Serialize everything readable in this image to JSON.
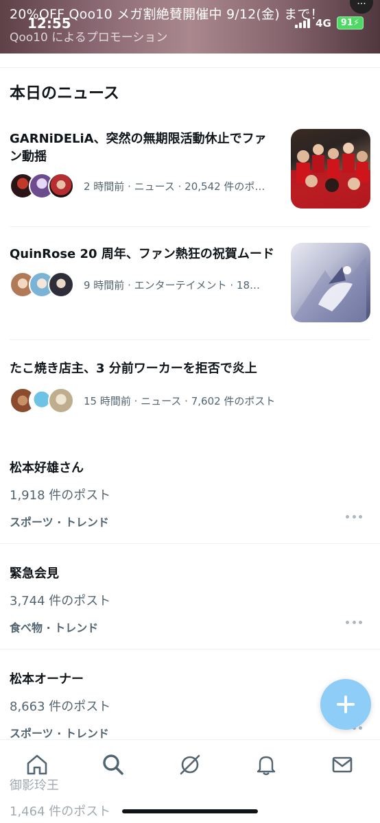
{
  "promo": {
    "title": "20%OFF Qoo10 メガ割絶賛開催中 9/12(金) まで！",
    "subtitle": "Qoo10 によるプロモーション"
  },
  "status_bar": {
    "time": "12:55",
    "network": "4G",
    "battery": "91"
  },
  "section": {
    "title": "本日のニュース"
  },
  "news": [
    {
      "headline": "GARNiDELiA、突然の無期限活動休止でファン動揺",
      "meta": "2 時間前 · ニュース · 20,542 件のポ…",
      "avatar_colors": [
        "#3a1d1f",
        "#6d4b8f",
        "#b62d32"
      ]
    },
    {
      "headline": "QuinRose 20 周年、ファン熱狂の祝賀ムード",
      "meta": "9 時間前 · エンターテイメント · 18…",
      "avatar_colors": [
        "#b07a56",
        "#7ab3d6",
        "#2e2e3a"
      ]
    },
    {
      "headline": "たこ焼き店主、3 分前ワーカーを拒否で炎上",
      "meta": "15 時間前 · ニュース · 7,602 件のポスト",
      "avatar_colors": [
        "#8a4b2e",
        "#6cc3e6",
        "#d8cbb0"
      ]
    }
  ],
  "trends": [
    {
      "name": "松本好雄さん",
      "count": "1,918 件のポスト",
      "category": "スポーツ · トレンド"
    },
    {
      "name": "緊急会見",
      "count": "3,744 件のポスト",
      "category": "食べ物 · トレンド"
    },
    {
      "name": "松本オーナー",
      "count": "8,663 件のポスト",
      "category": "スポーツ · トレンド"
    },
    {
      "name": "御影玲王",
      "count": "1,464 件のポスト"
    }
  ],
  "colors": {
    "accent": "#1d9bf0",
    "fab": "#8ecdf8",
    "muted_text": "#536471"
  },
  "icons": {
    "fab": "plus-icon",
    "nav": [
      "home-icon",
      "search-icon",
      "grok-icon",
      "bell-icon",
      "mail-icon"
    ]
  }
}
